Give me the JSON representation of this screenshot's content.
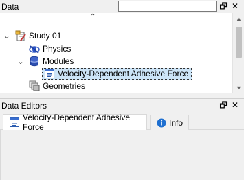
{
  "data_panel": {
    "title": "Data",
    "search": {
      "value": "",
      "placeholder": ""
    },
    "buttons": {
      "float": "🗗",
      "close": "✕"
    }
  },
  "tree": {
    "collapse_glyph": "⌃",
    "items": [
      {
        "label": "Study 01",
        "expander": "⌄",
        "icon": "study-icon"
      },
      {
        "label": "Physics",
        "expander": "",
        "icon": "physics-icon"
      },
      {
        "label": "Modules",
        "expander": "⌄",
        "icon": "database-icon"
      },
      {
        "label": "Velocity-Dependent Adhesive Force",
        "expander": "",
        "icon": "module-doc-icon",
        "selected": true
      },
      {
        "label": "Geometries",
        "expander": "",
        "icon": "geometries-icon"
      }
    ],
    "scrollbar": {
      "up": "▲",
      "down": "▼"
    }
  },
  "editors_panel": {
    "title": "Data Editors",
    "buttons": {
      "float": "🗗",
      "close": "✕"
    },
    "tabs": [
      {
        "label": "Velocity-Dependent Adhesive Force",
        "icon": "doc-icon",
        "active": true
      },
      {
        "label": "Info",
        "icon": "info-icon",
        "active": false
      }
    ]
  },
  "colors": {
    "selection": "#cce4f7",
    "info_blue": "#1e6fd0",
    "panel_bg": "#f0f0f0"
  }
}
